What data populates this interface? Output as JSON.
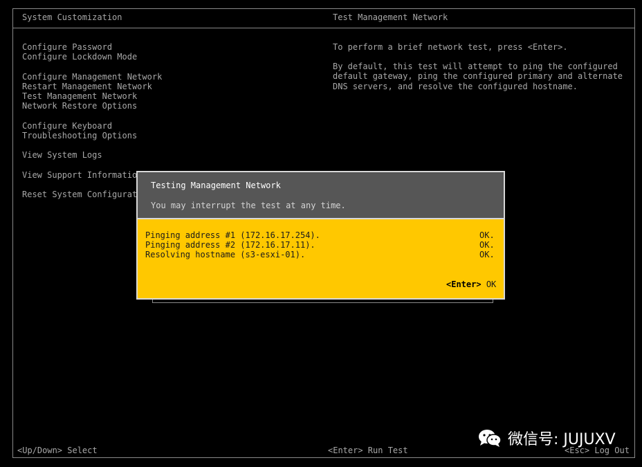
{
  "header": {
    "left_title": "System Customization",
    "right_title": "Test Management Network"
  },
  "menu": {
    "items": [
      "Configure Password",
      "Configure Lockdown Mode",
      "Configure Management Network",
      "Restart Management Network",
      "Test Management Network",
      "Network Restore Options",
      "Configure Keyboard",
      "Troubleshooting Options",
      "View System Logs",
      "View Support Informatio",
      "Reset System Configurat"
    ]
  },
  "description": {
    "line1": "To perform a brief network test, press <Enter>.",
    "para2": [
      "By default, this test will attempt to ping the configured",
      "default gateway, ping the configured primary and alternate",
      "DNS servers, and resolve the configured hostname."
    ]
  },
  "dialog": {
    "title": "Testing Management Network",
    "subtitle": "You may interrupt the test at any time.",
    "results": [
      {
        "label": "Pinging address #1 (172.16.17.254).",
        "status": "OK."
      },
      {
        "label": "Pinging address #2 (172.16.17.11).",
        "status": "OK."
      },
      {
        "label": "Resolving hostname (s3-esxi-01).",
        "status": "OK."
      }
    ],
    "action_key": "<Enter>",
    "action_label": "OK"
  },
  "footer": {
    "left": "<Up/Down> Select",
    "center": "<Enter> Run Test",
    "right": "<Esc> Log Out"
  },
  "watermark": {
    "icon": "wechat-icon",
    "text": "微信号: JUJUXV"
  }
}
